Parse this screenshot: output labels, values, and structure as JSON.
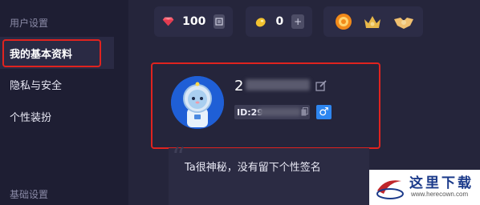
{
  "sidebar": {
    "user_settings_title": "用户设置",
    "items": [
      {
        "label": "我的基本资料",
        "active": true
      },
      {
        "label": "隐私与安全",
        "active": false
      },
      {
        "label": "个性装扮",
        "active": false
      }
    ],
    "basic_settings_title": "基础设置"
  },
  "currency": {
    "diamonds": "100",
    "beans": "0"
  },
  "profile": {
    "username_visible": "2",
    "id_prefix": "ID:29",
    "gender_symbol": "♂"
  },
  "signature": "Ta很神秘，没有留下个性签名",
  "watermark": {
    "text": "这里下载",
    "url": "www.herecown.com"
  },
  "colors": {
    "accent_red": "#e0231f",
    "gender_blue": "#2e86f0",
    "avatar_blue": "#1f5fd6"
  }
}
